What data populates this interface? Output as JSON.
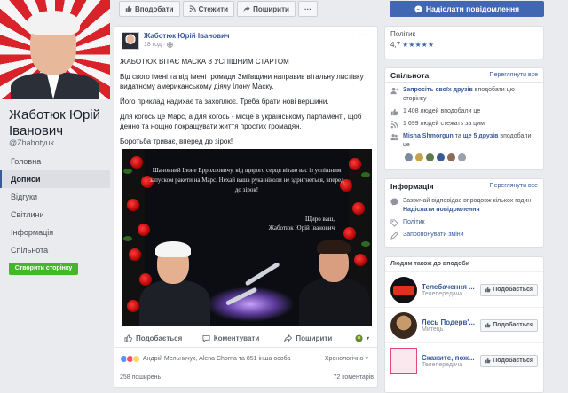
{
  "profile": {
    "name": "Жаботюк Юрій Іванович",
    "handle": "@Zhabotyuk",
    "nav": [
      "Головна",
      "Дописи",
      "Відгуки",
      "Світлини",
      "Інформація",
      "Спільнота"
    ],
    "create_page": "Створити сторінку"
  },
  "actions": {
    "like": "Вподобати",
    "follow": "Стежити",
    "share": "Поширити",
    "more": "···",
    "send_message": "Надіслати повідомлення"
  },
  "post": {
    "author": "Жаботюк Юрій Іванович",
    "time": "18 год ·",
    "menu": "···",
    "paragraphs": [
      "ЖАБОТЮК ВІТАЄ МАСКА З УСПІШНИМ СТАРТОМ",
      "Від свого імені та від імені громади Зміївщини направив вітальну листівку видатному американському діячу Ілону Маску.",
      "Його приклад надихає та захоплює. Треба брати нові вершини.",
      "Для когось це Марс, а для когось - місце в українському парламенті, щоб денно та нощно покращувати життя простих громадян.",
      "Боротьба триває, вперед до зірок!"
    ],
    "image": {
      "greeting": "Шановний Ілоне Ерролловичу, від щирого серця вітаю вас із успішним запуском ракети на Марс. Нехай ваша рука ніколи не здригнеться, вперед до зірок!",
      "signature_1": "Щиро ваш,",
      "signature_2": "Жаботюк Юрій Іванович"
    },
    "action_like": "Подобається",
    "action_comment": "Коментувати",
    "action_share": "Поширити",
    "reactions_text": "Андрій Мельничук, Alena Chorna та 851 інша особа",
    "chronology": "Хронологічно",
    "shares": "258 поширень",
    "comments": "72 коментарів",
    "reaction_colors": [
      "#5890ff",
      "#f25268",
      "#fcd669"
    ]
  },
  "right": {
    "category": "Політик",
    "rating": "4,7",
    "stars": "★★★★★",
    "community": {
      "title": "Спільнота",
      "see_all": "Переглянути все",
      "invite_link": "Запросіть своїх друзів",
      "invite_rest": "вподобати цю сторінку",
      "likes": "1 408 людей вподобали це",
      "follows": "1 699 людей стежать за цим",
      "friends_link_1": "Misha Shmorgun",
      "friends_mid": "та",
      "friends_link_2": "ще 5 друзів",
      "friends_rest": "вподобали це"
    },
    "info": {
      "title": "Інформація",
      "see_all": "Переглянути все",
      "response": "Зазвичай відповідає впродовж кількох годин",
      "send_link": "Надіслати повідомлення",
      "category": "Політик",
      "suggest_edits": "Запропонувати зміни"
    },
    "suggest": {
      "title": "Людям також до вподоби",
      "items": [
        {
          "name": "Телебачення ...",
          "category": "Телепередача"
        },
        {
          "name": "Лесь Подерв'...",
          "category": "Митець"
        },
        {
          "name": "Скажите, пож...",
          "category": "Телепередача"
        }
      ],
      "like_label": "Подобається"
    }
  }
}
